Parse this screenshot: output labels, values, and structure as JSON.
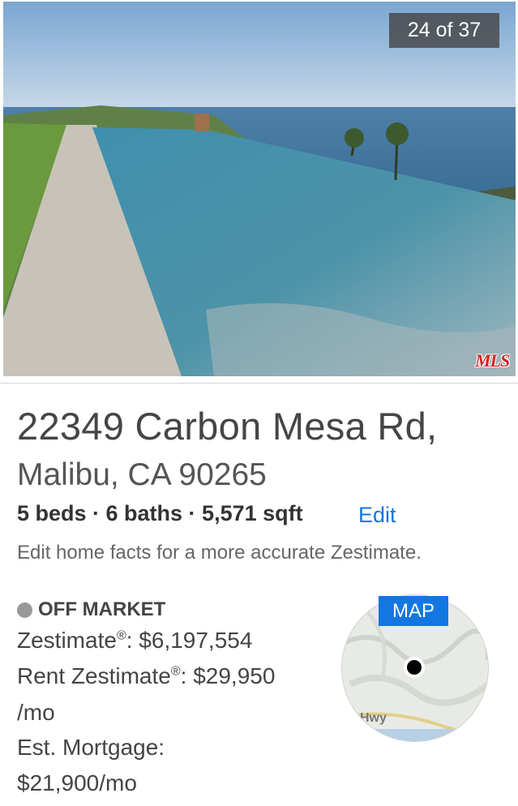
{
  "gallery": {
    "counter": "24 of 37",
    "logo_text": "MLS"
  },
  "address": {
    "street": "22349 Carbon Mesa Rd,",
    "city_line": "Malibu, CA 90265"
  },
  "facts": {
    "summary": "5 beds · 6 baths · 5,571 sqft",
    "edit_label": "Edit",
    "hint": "Edit home facts for a more accurate Zestimate."
  },
  "status": {
    "label": "OFF MARKET",
    "dot_color": "#999999"
  },
  "values": {
    "zestimate_label": "Zestimate",
    "zestimate_value": ": $6,197,554",
    "rent_label": "Rent Zestimate",
    "rent_value": ": $29,950",
    "rent_unit": "/mo",
    "mortgage_label": "Est. Mortgage:",
    "mortgage_value": "$21,900/mo",
    "registered_mark": "®"
  },
  "map": {
    "badge": "MAP",
    "road_label": "Hwy"
  },
  "colors": {
    "accent": "#1277e1"
  }
}
